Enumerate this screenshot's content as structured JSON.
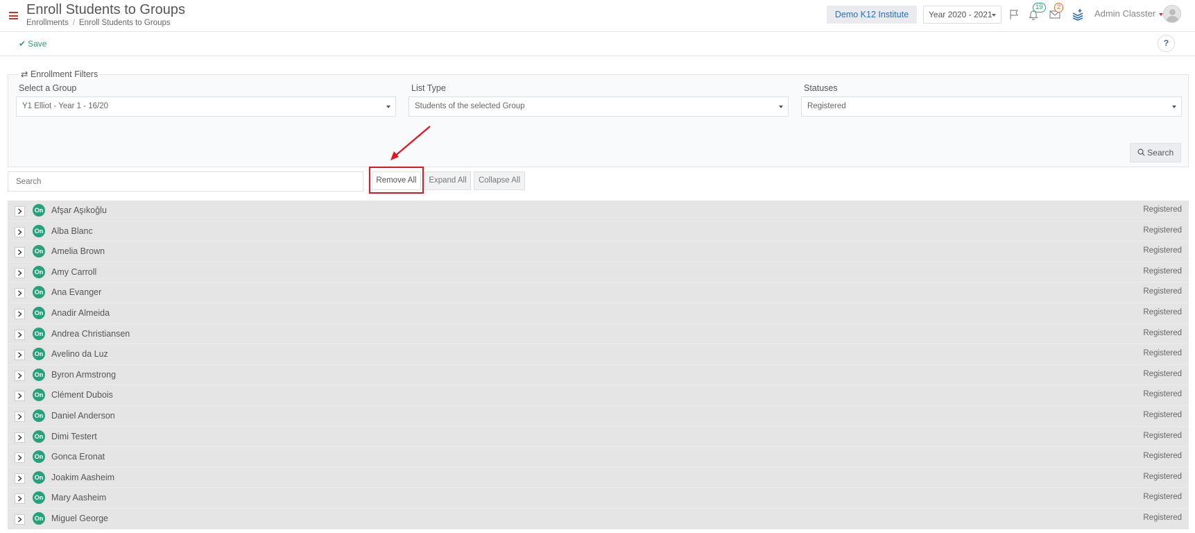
{
  "header": {
    "title": "Enroll Students to Groups",
    "breadcrumb": [
      "Enrollments",
      "Enroll Students to Groups"
    ],
    "institute": "Demo K12 Institute",
    "year": "Year 2020 - 2021",
    "notification_count": "19",
    "message_count": "2",
    "user": "Admin Classter"
  },
  "toolbar": {
    "save_label": "Save",
    "help_label": "?"
  },
  "filters": {
    "legend": "Enrollment Filters",
    "group_label": "Select a Group",
    "group_value": "Y1 Elliot - Year 1 - 16/20",
    "list_type_label": "List Type",
    "list_type_value": "Students of the selected Group",
    "statuses_label": "Statuses",
    "statuses_value": "Registered",
    "search_label": "Search"
  },
  "list_controls": {
    "search_placeholder": "Search",
    "remove_all": "Remove All",
    "expand_all": "Expand All",
    "collapse_all": "Collapse All"
  },
  "students": [
    {
      "badge": "On",
      "name": "Afşar Aşıkoğlu",
      "status": "Registered"
    },
    {
      "badge": "On",
      "name": "Alba Blanc",
      "status": "Registered"
    },
    {
      "badge": "On",
      "name": "Amelia Brown",
      "status": "Registered"
    },
    {
      "badge": "On",
      "name": "Amy Carroll",
      "status": "Registered"
    },
    {
      "badge": "On",
      "name": "Ana Evanger",
      "status": "Registered"
    },
    {
      "badge": "On",
      "name": "Anadir Almeida",
      "status": "Registered"
    },
    {
      "badge": "On",
      "name": "Andrea Christiansen",
      "status": "Registered"
    },
    {
      "badge": "On",
      "name": "Avelino da Luz",
      "status": "Registered"
    },
    {
      "badge": "On",
      "name": "Byron Armstrong",
      "status": "Registered"
    },
    {
      "badge": "On",
      "name": "Clément Dubois",
      "status": "Registered"
    },
    {
      "badge": "On",
      "name": "Daniel Anderson",
      "status": "Registered"
    },
    {
      "badge": "On",
      "name": "Dimi Testert",
      "status": "Registered"
    },
    {
      "badge": "On",
      "name": "Gonca Eronat",
      "status": "Registered"
    },
    {
      "badge": "On",
      "name": "Joakim Aasheim",
      "status": "Registered"
    },
    {
      "badge": "On",
      "name": "Mary Aasheim",
      "status": "Registered"
    },
    {
      "badge": "On",
      "name": "Miguel George",
      "status": "Registered"
    }
  ],
  "colors": {
    "accent_red": "#c9302c",
    "annotation_red": "#e8121b",
    "brand_blue": "#2b6eb5",
    "status_green": "#26a17b",
    "row_gray": "#e5e5e5"
  }
}
